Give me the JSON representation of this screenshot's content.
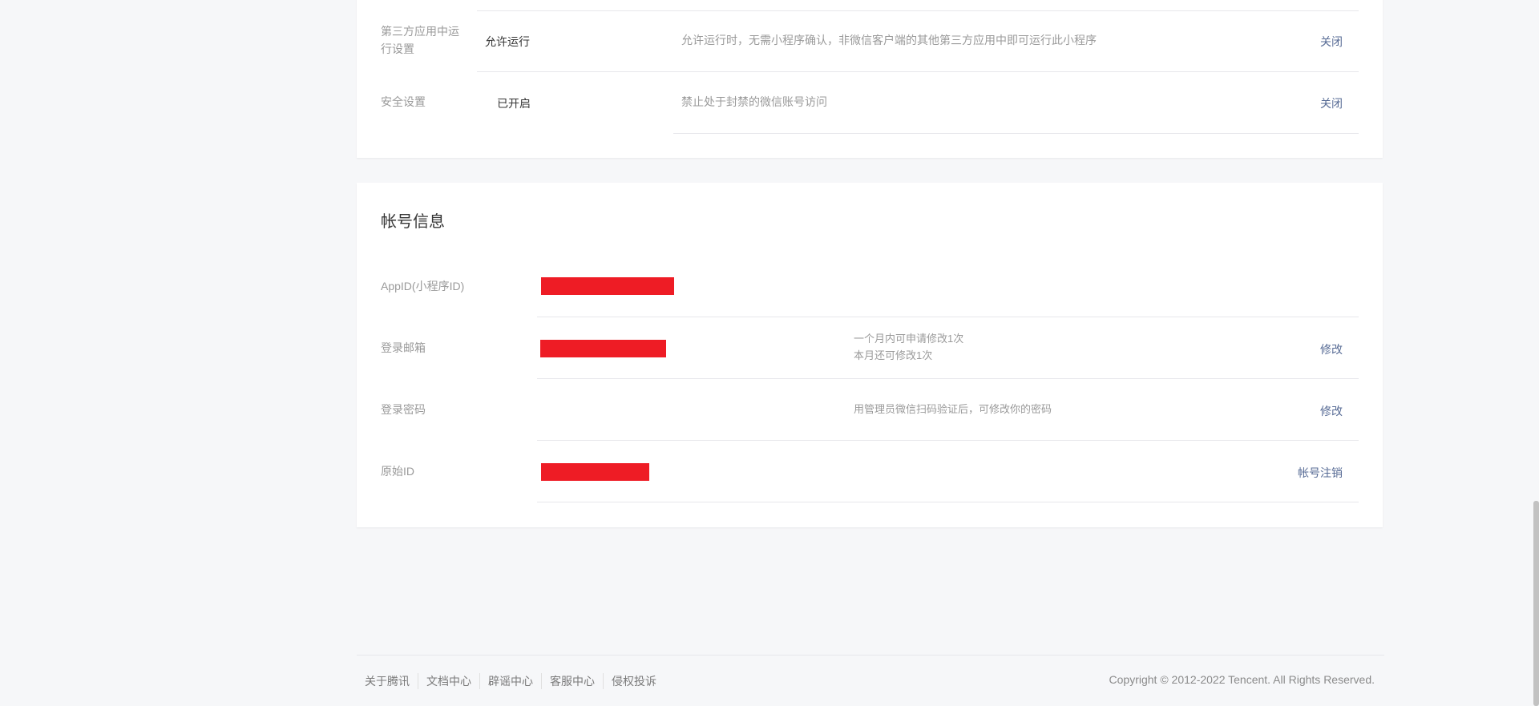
{
  "settings_card": {
    "third_party": {
      "label": "第三方应用中运行设置",
      "value": "允许运行",
      "desc": "允许运行时，无需小程序确认，非微信客户端的其他第三方应用中即可运行此小程序",
      "action": "关闭"
    },
    "security": {
      "label": "安全设置",
      "value": "已开启",
      "desc": "禁止处于封禁的微信账号访问",
      "action": "关闭"
    }
  },
  "account_card": {
    "title": "帐号信息",
    "appid": {
      "label": "AppID(小程序ID)"
    },
    "email": {
      "label": "登录邮箱",
      "desc_line1": "一个月内可申请修改1次",
      "desc_line2": "本月还可修改1次",
      "action": "修改"
    },
    "password": {
      "label": "登录密码",
      "desc": "用管理员微信扫码验证后，可修改你的密码",
      "action": "修改"
    },
    "original_id": {
      "label": "原始ID",
      "action": "帐号注销"
    }
  },
  "footer": {
    "links": [
      "关于腾讯",
      "文档中心",
      "辟谣中心",
      "客服中心",
      "侵权投诉"
    ],
    "copyright": "Copyright © 2012-2022 Tencent. All Rights Reserved."
  },
  "colors": {
    "link": "#576b95",
    "redaction": "#ee1c25",
    "background": "#f6f7f9"
  }
}
